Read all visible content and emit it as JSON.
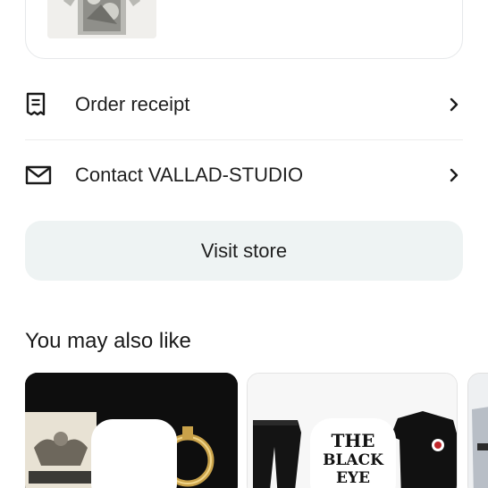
{
  "order": {
    "thumb_icon": "sweater-product-image"
  },
  "links": [
    {
      "label": "Order receipt",
      "icon": "receipt-icon"
    },
    {
      "label": "Contact VALLAD-STUDIO",
      "icon": "mail-icon"
    }
  ],
  "visit_store_label": "Visit store",
  "recommendations": {
    "title": "You may also like",
    "items": [
      {
        "image": "jewelry-hoop-earring-product"
      },
      {
        "image": "black-eye-patch-apparel-product",
        "logo_text": "THE BLACK EYE PATCH"
      },
      {
        "image": "partial-apparel-product"
      }
    ]
  }
}
